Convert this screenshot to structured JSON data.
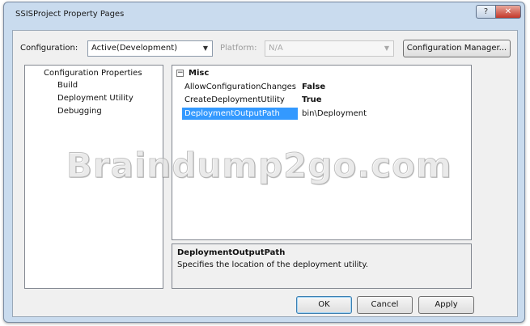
{
  "window": {
    "title": "SSISProject Property Pages",
    "help_glyph": "?",
    "close_glyph": "✕"
  },
  "toolbar": {
    "configuration_label": "Configuration:",
    "configuration_value": "Active(Development)",
    "platform_label": "Platform:",
    "platform_value": "N/A",
    "config_manager_label": "Configuration Manager..."
  },
  "tree": {
    "items": [
      {
        "label": "Configuration Properties"
      },
      {
        "label": "Build"
      },
      {
        "label": "Deployment Utility"
      },
      {
        "label": "Debugging"
      }
    ]
  },
  "grid": {
    "category": {
      "label": "Misc",
      "toggle": "−"
    },
    "properties": [
      {
        "name": "AllowConfigurationChanges",
        "value": "False"
      },
      {
        "name": "CreateDeploymentUtility",
        "value": "True"
      },
      {
        "name": "DeploymentOutputPath",
        "value": "bin\\Deployment"
      }
    ]
  },
  "description": {
    "title": "DeploymentOutputPath",
    "text": "Specifies the location of the deployment utility."
  },
  "buttons": {
    "ok": "OK",
    "cancel": "Cancel",
    "apply": "Apply"
  },
  "watermark": "Braindump2go.com",
  "colors": {
    "selection": "#3399ff",
    "frame": "#c9dbee",
    "close_button": "#c4382a"
  }
}
